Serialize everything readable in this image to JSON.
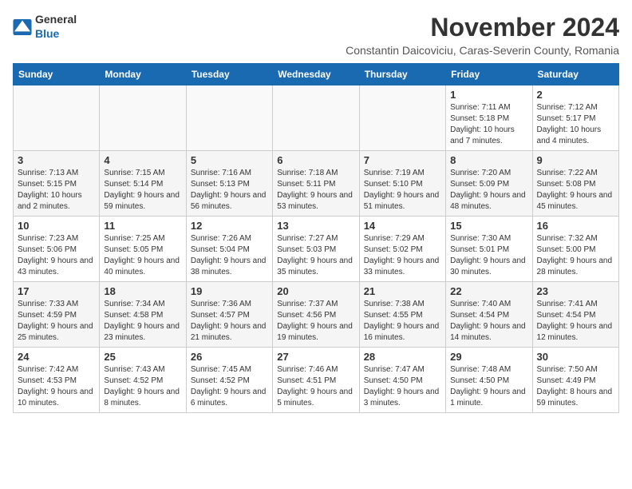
{
  "header": {
    "logo_general": "General",
    "logo_blue": "Blue",
    "month_title": "November 2024",
    "subtitle": "Constantin Daicoviciu, Caras-Severin County, Romania"
  },
  "weekdays": [
    "Sunday",
    "Monday",
    "Tuesday",
    "Wednesday",
    "Thursday",
    "Friday",
    "Saturday"
  ],
  "weeks": [
    [
      {
        "day": "",
        "info": ""
      },
      {
        "day": "",
        "info": ""
      },
      {
        "day": "",
        "info": ""
      },
      {
        "day": "",
        "info": ""
      },
      {
        "day": "",
        "info": ""
      },
      {
        "day": "1",
        "info": "Sunrise: 7:11 AM\nSunset: 5:18 PM\nDaylight: 10 hours and 7 minutes."
      },
      {
        "day": "2",
        "info": "Sunrise: 7:12 AM\nSunset: 5:17 PM\nDaylight: 10 hours and 4 minutes."
      }
    ],
    [
      {
        "day": "3",
        "info": "Sunrise: 7:13 AM\nSunset: 5:15 PM\nDaylight: 10 hours and 2 minutes."
      },
      {
        "day": "4",
        "info": "Sunrise: 7:15 AM\nSunset: 5:14 PM\nDaylight: 9 hours and 59 minutes."
      },
      {
        "day": "5",
        "info": "Sunrise: 7:16 AM\nSunset: 5:13 PM\nDaylight: 9 hours and 56 minutes."
      },
      {
        "day": "6",
        "info": "Sunrise: 7:18 AM\nSunset: 5:11 PM\nDaylight: 9 hours and 53 minutes."
      },
      {
        "day": "7",
        "info": "Sunrise: 7:19 AM\nSunset: 5:10 PM\nDaylight: 9 hours and 51 minutes."
      },
      {
        "day": "8",
        "info": "Sunrise: 7:20 AM\nSunset: 5:09 PM\nDaylight: 9 hours and 48 minutes."
      },
      {
        "day": "9",
        "info": "Sunrise: 7:22 AM\nSunset: 5:08 PM\nDaylight: 9 hours and 45 minutes."
      }
    ],
    [
      {
        "day": "10",
        "info": "Sunrise: 7:23 AM\nSunset: 5:06 PM\nDaylight: 9 hours and 43 minutes."
      },
      {
        "day": "11",
        "info": "Sunrise: 7:25 AM\nSunset: 5:05 PM\nDaylight: 9 hours and 40 minutes."
      },
      {
        "day": "12",
        "info": "Sunrise: 7:26 AM\nSunset: 5:04 PM\nDaylight: 9 hours and 38 minutes."
      },
      {
        "day": "13",
        "info": "Sunrise: 7:27 AM\nSunset: 5:03 PM\nDaylight: 9 hours and 35 minutes."
      },
      {
        "day": "14",
        "info": "Sunrise: 7:29 AM\nSunset: 5:02 PM\nDaylight: 9 hours and 33 minutes."
      },
      {
        "day": "15",
        "info": "Sunrise: 7:30 AM\nSunset: 5:01 PM\nDaylight: 9 hours and 30 minutes."
      },
      {
        "day": "16",
        "info": "Sunrise: 7:32 AM\nSunset: 5:00 PM\nDaylight: 9 hours and 28 minutes."
      }
    ],
    [
      {
        "day": "17",
        "info": "Sunrise: 7:33 AM\nSunset: 4:59 PM\nDaylight: 9 hours and 25 minutes."
      },
      {
        "day": "18",
        "info": "Sunrise: 7:34 AM\nSunset: 4:58 PM\nDaylight: 9 hours and 23 minutes."
      },
      {
        "day": "19",
        "info": "Sunrise: 7:36 AM\nSunset: 4:57 PM\nDaylight: 9 hours and 21 minutes."
      },
      {
        "day": "20",
        "info": "Sunrise: 7:37 AM\nSunset: 4:56 PM\nDaylight: 9 hours and 19 minutes."
      },
      {
        "day": "21",
        "info": "Sunrise: 7:38 AM\nSunset: 4:55 PM\nDaylight: 9 hours and 16 minutes."
      },
      {
        "day": "22",
        "info": "Sunrise: 7:40 AM\nSunset: 4:54 PM\nDaylight: 9 hours and 14 minutes."
      },
      {
        "day": "23",
        "info": "Sunrise: 7:41 AM\nSunset: 4:54 PM\nDaylight: 9 hours and 12 minutes."
      }
    ],
    [
      {
        "day": "24",
        "info": "Sunrise: 7:42 AM\nSunset: 4:53 PM\nDaylight: 9 hours and 10 minutes."
      },
      {
        "day": "25",
        "info": "Sunrise: 7:43 AM\nSunset: 4:52 PM\nDaylight: 9 hours and 8 minutes."
      },
      {
        "day": "26",
        "info": "Sunrise: 7:45 AM\nSunset: 4:52 PM\nDaylight: 9 hours and 6 minutes."
      },
      {
        "day": "27",
        "info": "Sunrise: 7:46 AM\nSunset: 4:51 PM\nDaylight: 9 hours and 5 minutes."
      },
      {
        "day": "28",
        "info": "Sunrise: 7:47 AM\nSunset: 4:50 PM\nDaylight: 9 hours and 3 minutes."
      },
      {
        "day": "29",
        "info": "Sunrise: 7:48 AM\nSunset: 4:50 PM\nDaylight: 9 hours and 1 minute."
      },
      {
        "day": "30",
        "info": "Sunrise: 7:50 AM\nSunset: 4:49 PM\nDaylight: 8 hours and 59 minutes."
      }
    ]
  ]
}
